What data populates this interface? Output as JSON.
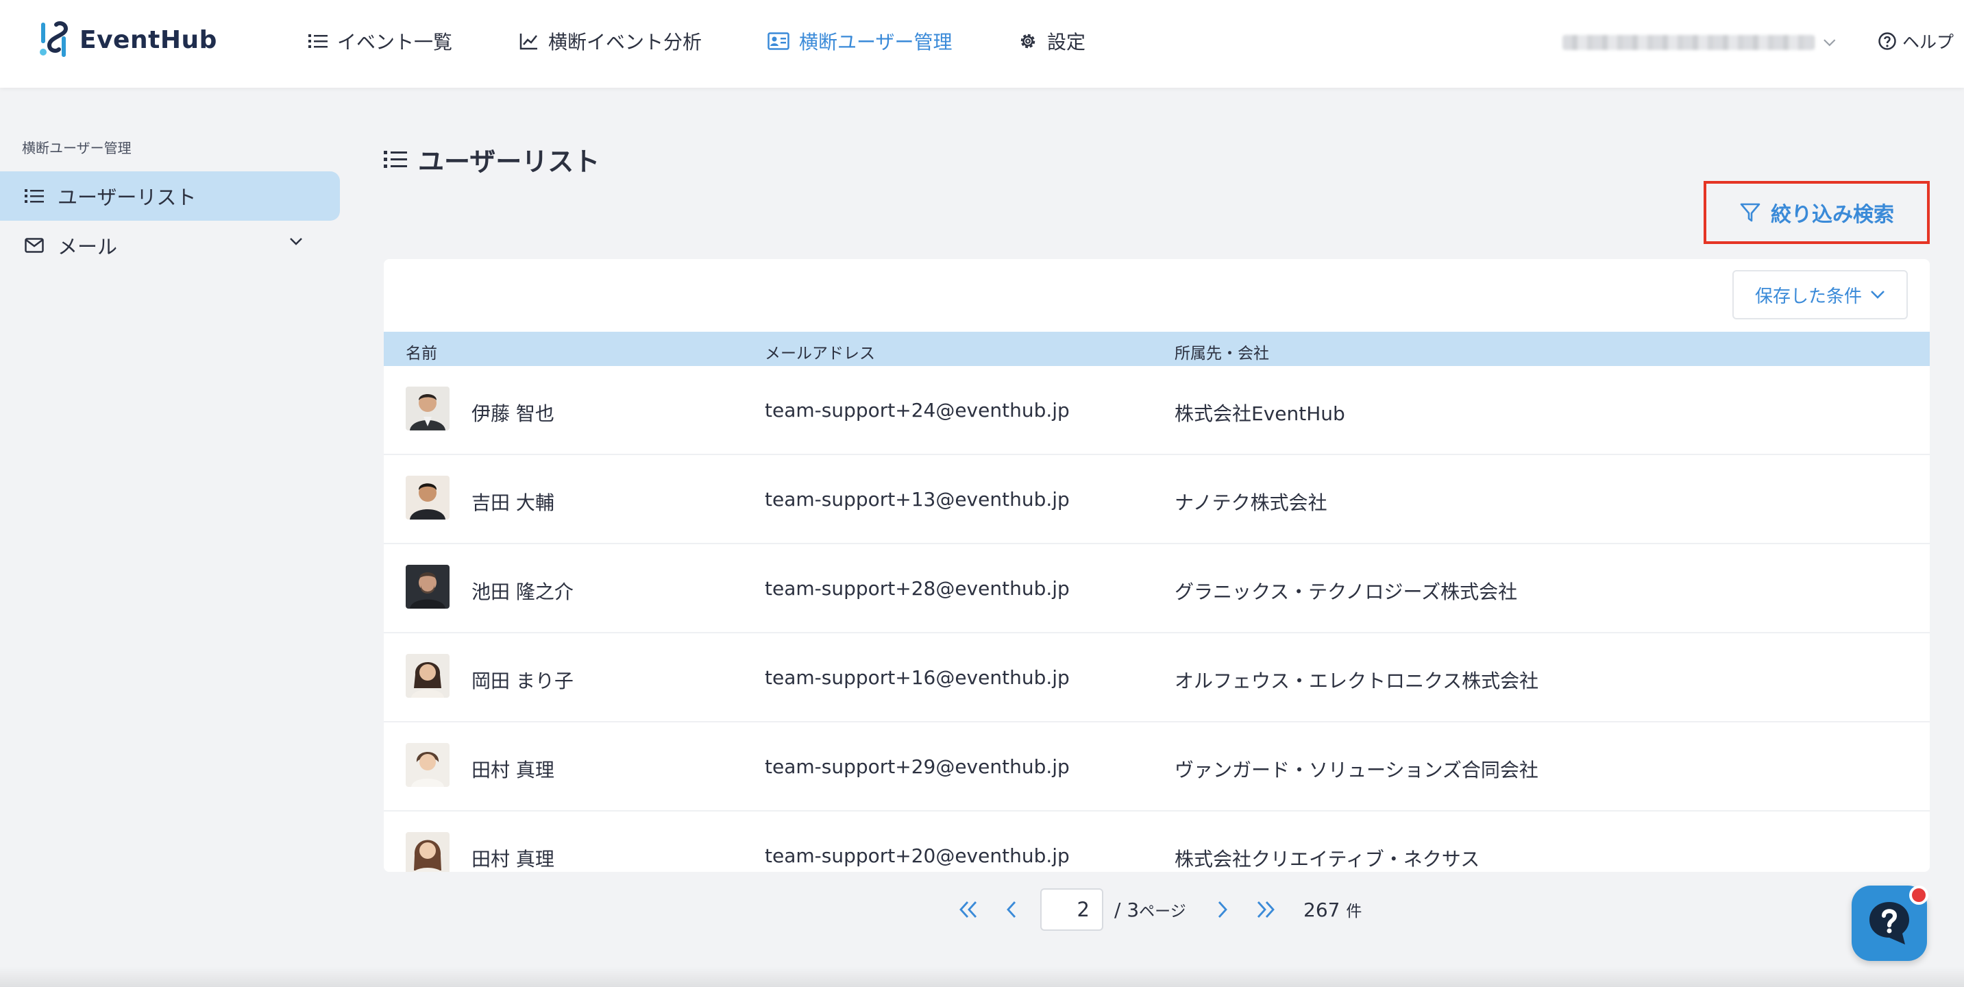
{
  "app": {
    "name": "EventHub",
    "brand_colors": {
      "accent": "#3a8ad8",
      "active_bg": "#c4dff4",
      "highlight": "#e53525",
      "navy": "#1f2d4d"
    }
  },
  "header": {
    "nav": [
      {
        "label": "イベント一覧",
        "icon": "list-icon",
        "active": false
      },
      {
        "label": "横断イベント分析",
        "icon": "trend-chart-icon",
        "active": false
      },
      {
        "label": "横断ユーザー管理",
        "icon": "id-card-icon",
        "active": true
      },
      {
        "label": "設定",
        "icon": "gear-icon",
        "active": false
      }
    ],
    "help_label": "ヘルプ"
  },
  "sidebar": {
    "section_title": "横断ユーザー管理",
    "items": [
      {
        "label": "ユーザーリスト",
        "icon": "list-icon",
        "active": true
      },
      {
        "label": "メール",
        "icon": "mail-icon",
        "active": false,
        "expandable": true
      }
    ]
  },
  "main": {
    "title": "ユーザーリスト",
    "filter_button": "絞り込み検索",
    "saved_conditions_button": "保存した条件",
    "table": {
      "columns": [
        "名前",
        "メールアドレス",
        "所属先・会社"
      ],
      "rows": [
        {
          "name": "伊藤 智也",
          "email": "team-support+24@eventhub.jp",
          "company": "株式会社EventHub"
        },
        {
          "name": "吉田 大輔",
          "email": "team-support+13@eventhub.jp",
          "company": "ナノテク株式会社"
        },
        {
          "name": "池田 隆之介",
          "email": "team-support+28@eventhub.jp",
          "company": "グラニックス・テクノロジーズ株式会社"
        },
        {
          "name": "岡田 まり子",
          "email": "team-support+16@eventhub.jp",
          "company": "オルフェウス・エレクトロニクス株式会社"
        },
        {
          "name": "田村 真理",
          "email": "team-support+29@eventhub.jp",
          "company": "ヴァンガード・ソリューションズ合同会社"
        },
        {
          "name": "田村 真理",
          "email": "team-support+20@eventhub.jp",
          "company": "株式会社クリエイティブ・ネクサス"
        }
      ]
    },
    "pagination": {
      "current_page": "2",
      "total_pages_label": "/ 3",
      "page_unit": "ページ",
      "total_count": "267",
      "count_unit": "件"
    }
  }
}
